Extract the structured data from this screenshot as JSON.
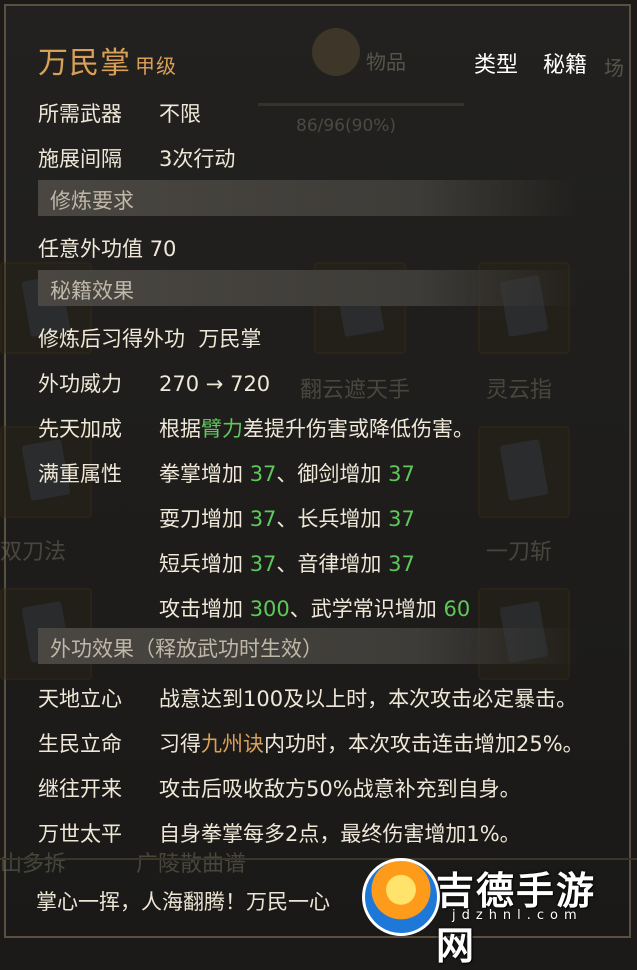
{
  "background": {
    "tab_items": "物品",
    "tab_next": "场",
    "progress": "86/96(90%)",
    "slot_labels": [
      "翻云遮天手",
      "灵云指",
      "双刀法",
      "一刀斩",
      "山多拆",
      "广陵散曲谱"
    ]
  },
  "tooltip": {
    "title": "万民掌",
    "grade": "甲级",
    "type_label": "类型",
    "type_value": "秘籍",
    "weapon": {
      "key": "所需武器",
      "value": "不限"
    },
    "interval": {
      "key": "施展间隔",
      "value": "3次行动"
    },
    "section_requirements": "修炼要求",
    "requirement": {
      "key": "任意外功值",
      "value": "70"
    },
    "section_effects": "秘籍效果",
    "learned": {
      "key": "修炼后习得外功",
      "value": "万民掌"
    },
    "power": {
      "key": "外功威力",
      "from": "270",
      "arrow": "→",
      "to": "720"
    },
    "innate": {
      "key": "先天加成",
      "pre": "根据",
      "stat": "臂力",
      "post": "差提升伤害或降低伤害。"
    },
    "full": {
      "key": "满重属性",
      "lines": [
        {
          "a": "拳掌增加 ",
          "av": "37",
          "sep": "、",
          "b": "御剑增加 ",
          "bv": "37"
        },
        {
          "a": "耍刀增加 ",
          "av": "37",
          "sep": "、",
          "b": "长兵增加 ",
          "bv": "37"
        },
        {
          "a": "短兵增加 ",
          "av": "37",
          "sep": "、",
          "b": "音律增加 ",
          "bv": "37"
        },
        {
          "a": "攻击增加 ",
          "av": "300",
          "sep": "、",
          "b": "武学常识增加 ",
          "bv": "60"
        }
      ]
    },
    "section_external": "外功效果（释放武功时生效）",
    "effects": [
      {
        "key": "天地立心",
        "value": "战意达到100及以上时，本次攻击必定暴击。"
      },
      {
        "key": "生民立命",
        "pre": "习得",
        "hl": "九州诀",
        "post": "内功时，本次攻击连击增加25%。"
      },
      {
        "key": "继往开来",
        "value": "攻击后吸收敌方50%战意补充到自身。"
      },
      {
        "key": "万世太平",
        "value": "自身拳掌每多2点，最终伤害增加1%。"
      }
    ],
    "flavor": "掌心一挥，人海翻腾！万民一心"
  },
  "watermark": {
    "title": "吉德手游网",
    "sub": "jdzhnl.com"
  },
  "colors": {
    "title": "#d9a058",
    "highlight": "#5fc85a",
    "text": "#efe8d8"
  }
}
